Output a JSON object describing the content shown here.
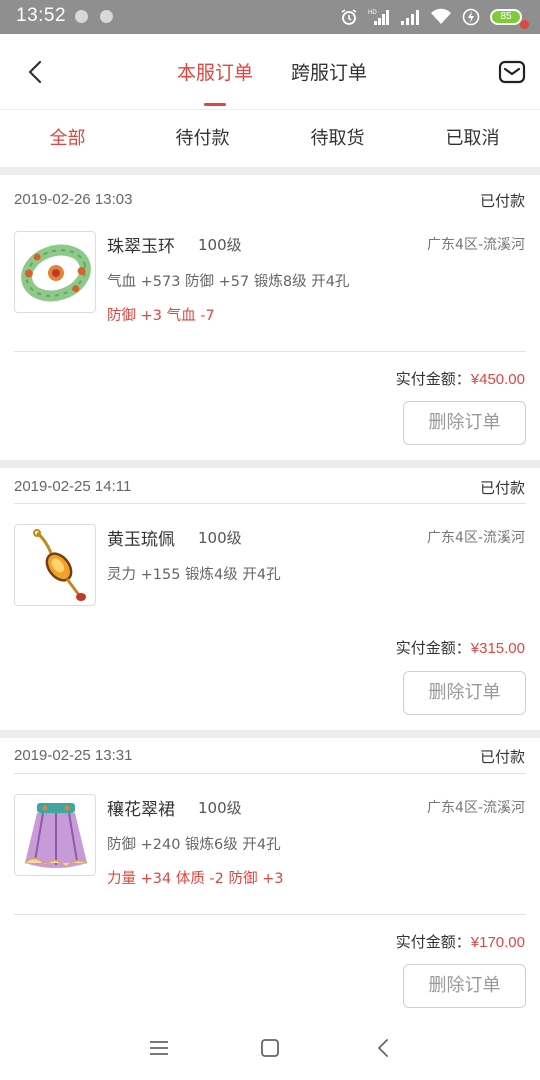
{
  "status_bar": {
    "time": "13:52",
    "battery": "85",
    "icons": [
      "alarm-icon",
      "hd-signal-icon",
      "signal-icon",
      "wifi-icon",
      "charging-icon",
      "battery-icon"
    ]
  },
  "header": {
    "tabs": [
      {
        "label": "本服订单",
        "active": true
      },
      {
        "label": "跨服订单",
        "active": false
      }
    ],
    "accent_color": "#e0463f"
  },
  "filters": [
    {
      "label": "全部",
      "active": true
    },
    {
      "label": "待付款",
      "active": false
    },
    {
      "label": "待取货",
      "active": false
    },
    {
      "label": "已取消",
      "active": false
    }
  ],
  "orders": [
    {
      "date": "2019-02-26 13:03",
      "status": "已付款",
      "item": {
        "name": "珠翠玉环",
        "level": "100级",
        "server": "广东4区-流溪河",
        "attrs": "气血 +573 防御 +57 锻炼8级 开4孔",
        "extra": "防御 +3 气血 -7",
        "icon": "jade-ring-icon"
      },
      "paid_label": "实付金额：",
      "paid_amount": "¥450.00",
      "delete_label": "删除订单"
    },
    {
      "date": "2019-02-25 14:11",
      "status": "已付款",
      "item": {
        "name": "黄玉琉佩",
        "level": "100级",
        "server": "广东4区-流溪河",
        "attrs": "灵力 +155 锻炼4级 开4孔",
        "extra": "",
        "icon": "topaz-pendant-icon"
      },
      "paid_label": "实付金额：",
      "paid_amount": "¥315.00",
      "delete_label": "删除订单"
    },
    {
      "date": "2019-02-25 13:31",
      "status": "已付款",
      "item": {
        "name": "穰花翠裙",
        "level": "100级",
        "server": "广东4区-流溪河",
        "attrs": "防御 +240 锻炼6级 开4孔",
        "extra": "力量 +34 体质 -2 防御 +3",
        "icon": "flower-skirt-icon"
      },
      "paid_label": "实付金额：",
      "paid_amount": "¥170.00",
      "delete_label": "删除订单"
    }
  ],
  "nav_bar": {
    "icons": [
      "menu-icon",
      "home-square-icon",
      "back-chevron-icon"
    ]
  }
}
